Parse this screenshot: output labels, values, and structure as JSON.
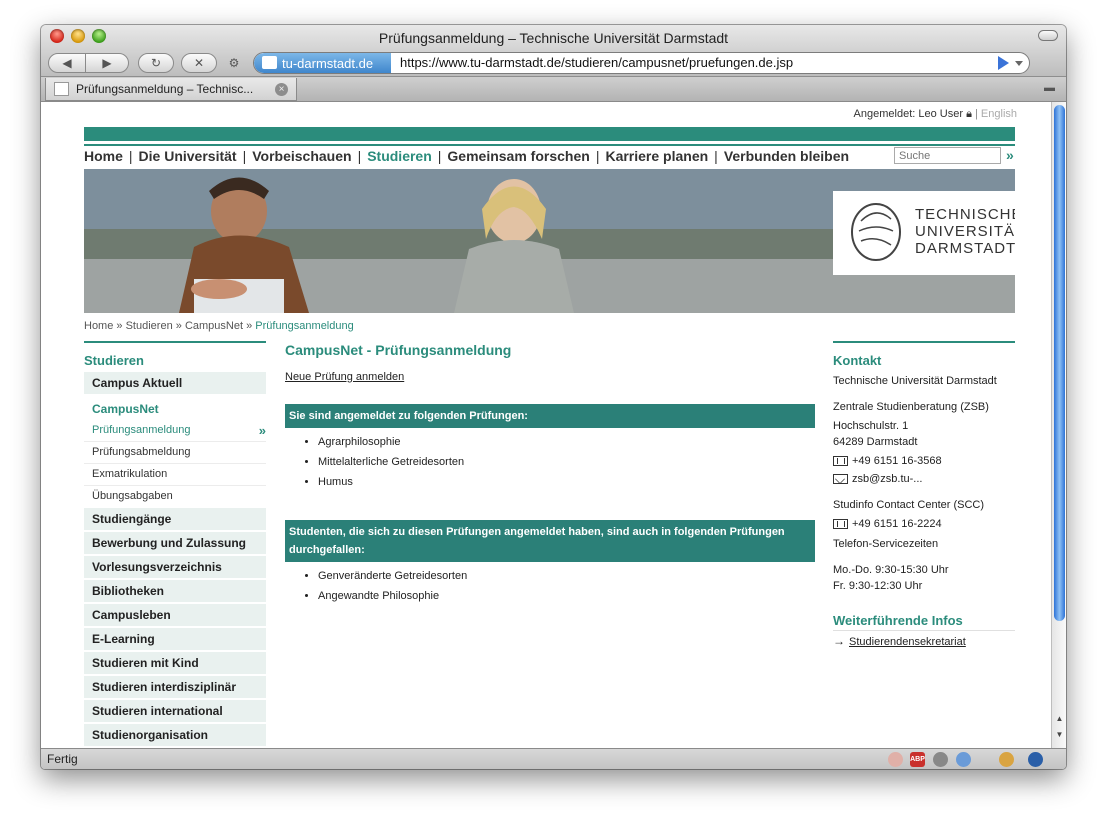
{
  "window": {
    "title": "Prüfungsanmeldung – Technische Universität Darmstadt"
  },
  "toolbar": {
    "back": "◀",
    "forward": "▶",
    "reload": "↻",
    "stop": "✕",
    "gear": "⚙"
  },
  "address": {
    "site": "tu-darmstadt.de",
    "url": "https://www.tu-darmstadt.de/studieren/campusnet/pruefungen.de.jsp"
  },
  "tab": {
    "label": "Prüfungsanmeldung – Technisc...",
    "close": "×"
  },
  "status": {
    "text": "Fertig",
    "abp": "ABP"
  },
  "page": {
    "user": {
      "label": "Angemeldet:",
      "name": "Leo User",
      "sep": "|",
      "lang": "English"
    },
    "nav": [
      {
        "label": "Home"
      },
      {
        "label": "Die Universität"
      },
      {
        "label": "Vorbeischauen"
      },
      {
        "label": "Studieren",
        "active": true
      },
      {
        "label": "Gemeinsam forschen"
      },
      {
        "label": "Karriere planen"
      },
      {
        "label": "Verbunden bleiben"
      }
    ],
    "nav_sep": "|",
    "search": {
      "placeholder": "Suche",
      "go": "»"
    },
    "logo": {
      "line1": "TECHNISCHE",
      "line2": "UNIVERSITÄT",
      "line3": "DARMSTADT"
    },
    "breadcrumb": {
      "home": "Home",
      "sep": "»",
      "studieren": "Studieren",
      "campusnet": "CampusNet",
      "current": "Prüfungsanmeldung"
    },
    "left": {
      "title": "Studieren",
      "campus_aktuell": "Campus Aktuell",
      "campusnet": "CampusNet",
      "sub": [
        "Prüfungsanmeldung",
        "Prüfungsabmeldung",
        "Exmatrikulation",
        "Übungsabgaben"
      ],
      "chev": "»",
      "items": [
        "Studiengänge",
        "Bewerbung und Zulassung",
        "Vorlesungsverzeichnis",
        "Bibliotheken",
        "Campusleben",
        "E-Learning",
        "Studieren mit Kind",
        "Studieren interdisziplinär",
        "Studieren international",
        "Studienorganisation"
      ]
    },
    "main": {
      "title": "CampusNet - Prüfungsanmeldung",
      "link": "Neue Prüfung anmelden",
      "box1": "Sie sind angemeldet zu folgenden Prüfungen:",
      "list1": [
        "Agrarphilosophie",
        "Mittelalterliche Getreidesorten",
        "Humus"
      ],
      "box2": "Studenten, die sich zu diesen Prüfungen angemeldet haben, sind auch in folgenden Prüfungen durchgefallen:",
      "list2": [
        "Genveränderte Getreidesorten",
        "Angewandte Philosophie"
      ]
    },
    "right": {
      "title": "Kontakt",
      "org": "Technische Universität Darmstadt",
      "zsb": "Zentrale Studienberatung (ZSB)",
      "street": "Hochschulstr. 1",
      "city": "64289 Darmstadt",
      "phone1": "+49 6151 16-3568",
      "email": "zsb@zsb.tu-...",
      "scc": "Studinfo Contact Center (SCC)",
      "phone2": "+49 6151 16-2224",
      "service": "Telefon-Servicezeiten",
      "hours1": "Mo.-Do. 9:30-15:30 Uhr",
      "hours2": "Fr. 9:30-12:30 Uhr",
      "more_title": "Weiterführende Infos",
      "more_link": "Studierendensekretariat",
      "more_arrow": "→"
    }
  },
  "colors": {
    "accent": "#2b8c7c",
    "box": "#2b8078"
  }
}
